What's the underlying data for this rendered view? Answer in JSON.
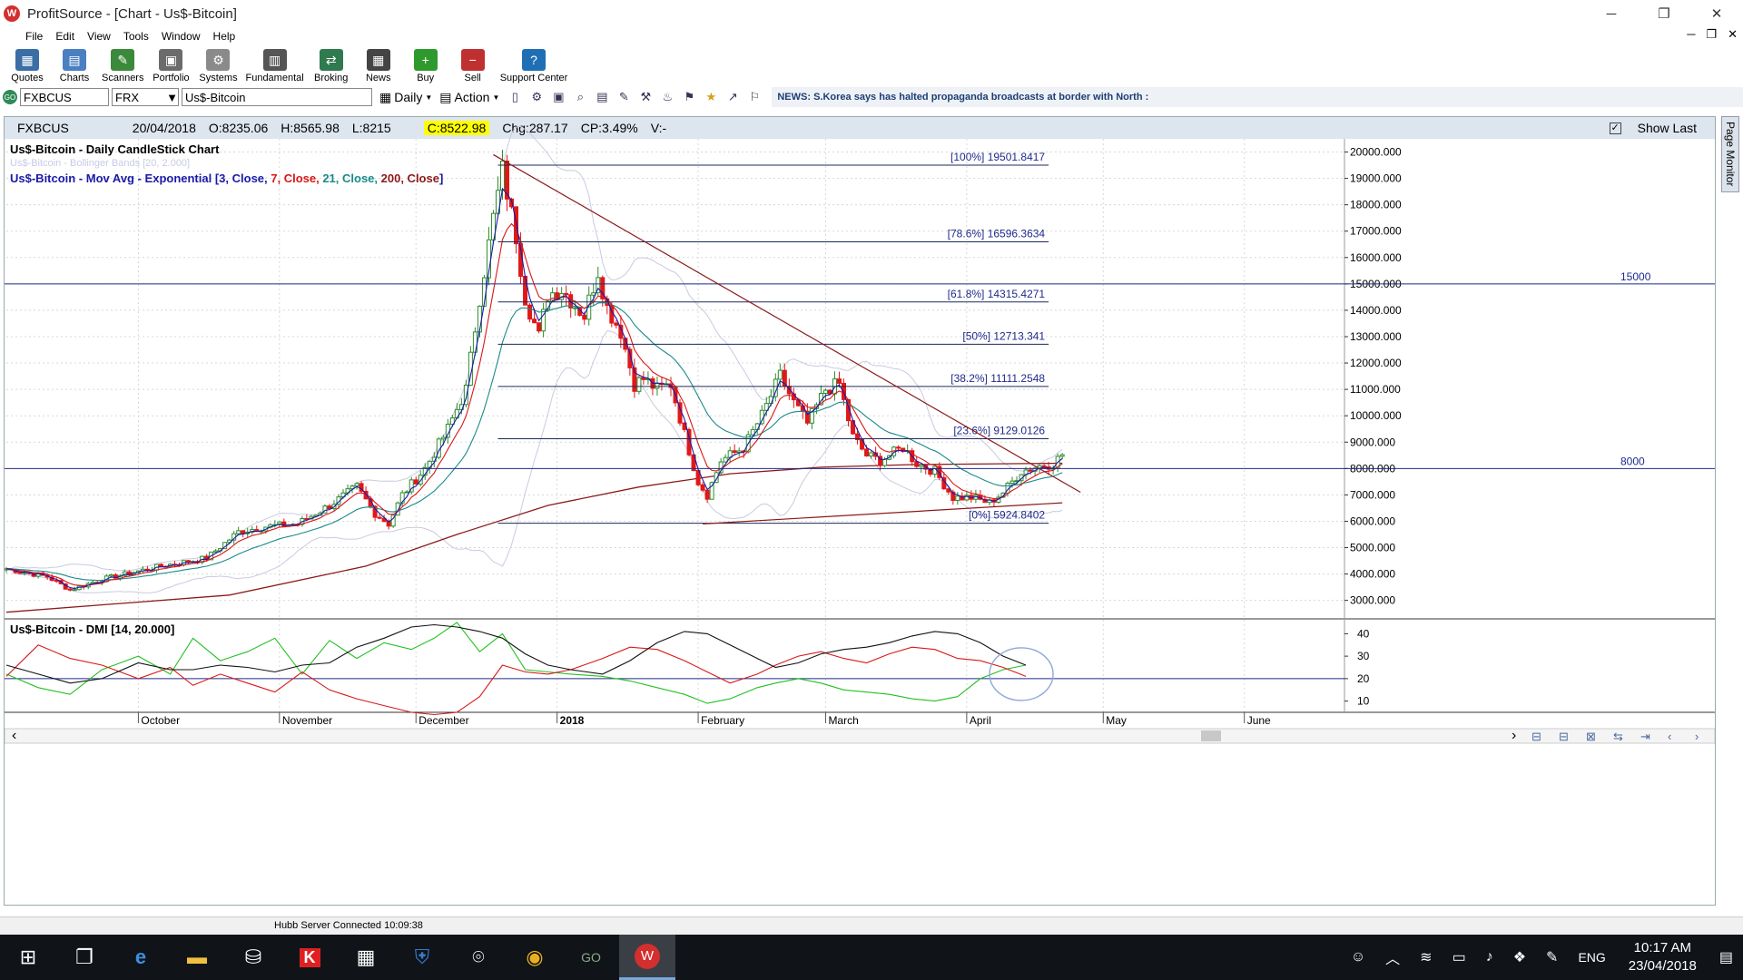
{
  "window": {
    "title": "ProfitSource - [Chart - Us$-Bitcoin]",
    "app_icon_text": "W"
  },
  "menu": [
    "File",
    "Edit",
    "View",
    "Tools",
    "Window",
    "Help"
  ],
  "toolbar": [
    {
      "label": "Quotes",
      "color": "#3a6ea5",
      "glyph": "▦"
    },
    {
      "label": "Charts",
      "color": "#4a7fc1",
      "glyph": "▤"
    },
    {
      "label": "Scanners",
      "color": "#3b8a3b",
      "glyph": "✎"
    },
    {
      "label": "Portfolio",
      "color": "#6b6b6b",
      "glyph": "▣"
    },
    {
      "label": "Systems",
      "color": "#8a8a8a",
      "glyph": "⚙"
    },
    {
      "label": "Fundamental",
      "color": "#555555",
      "glyph": "▥"
    },
    {
      "label": "Broking",
      "color": "#2f7a4f",
      "glyph": "⇄"
    },
    {
      "label": "News",
      "color": "#444444",
      "glyph": "▦"
    },
    {
      "label": "Buy",
      "color": "#2e9a2e",
      "glyph": "+"
    },
    {
      "label": "Sell",
      "color": "#c03030",
      "glyph": "−"
    },
    {
      "label": "Support Center",
      "color": "#1f6fb5",
      "glyph": "?"
    }
  ],
  "symbol_bar": {
    "go": "GO",
    "symbol": "FXBCUS",
    "exchange": "FRX",
    "name": "Us$-Bitcoin",
    "period": "Daily",
    "action": "Action",
    "news": "NEWS: S.Korea says has halted propaganda broadcasts at border with North :"
  },
  "info": {
    "code": "FXBCUS",
    "date": "20/04/2018",
    "open": "O:8235.06",
    "high": "H:8565.98",
    "low": "L:8215",
    "close": "C:8522.98",
    "change": "Chg:287.17",
    "cp": "CP:3.49%",
    "vol": "V:-",
    "show_last": "Show Last"
  },
  "page_monitor": "Page Monitor",
  "status": {
    "text": "Hubb Server Connected 10:09:38"
  },
  "taskbar": {
    "lang": "ENG",
    "time": "10:17 AM",
    "date": "23/04/2018"
  },
  "chart_data": {
    "type": "candlestick",
    "title": "Us$-Bitcoin - Daily CandleStick Chart",
    "subtitle": "Us$-Bitcoin - Bollinger Bands [20, 2.000]",
    "ma_prefix": "Us$-Bitcoin - Mov Avg - Exponential [",
    "ma_parts": [
      {
        "text": "3, Close, ",
        "color": "#1a1aa8"
      },
      {
        "text": "7, Close, ",
        "color": "#d81818"
      },
      {
        "text": "21, Close, ",
        "color": "#1a8a8a"
      },
      {
        "text": "200, Close",
        "color": "#8b1a1a"
      }
    ],
    "ma_suffix": "]",
    "y_ticks": [
      "20000.000",
      "19000.000",
      "18000.000",
      "17000.000",
      "16000.000",
      "15000.000",
      "14000.000",
      "13000.000",
      "12000.000",
      "11000.000",
      "10000.000",
      "9000.000",
      "8000.000",
      "7000.000",
      "6000.000",
      "5000.000",
      "4000.000",
      "3000.000"
    ],
    "y_range": [
      2300,
      20500
    ],
    "x_labels": [
      {
        "text": "October",
        "x": 0
      },
      {
        "text": "November",
        "x": 31
      },
      {
        "text": "December",
        "x": 61
      },
      {
        "text": "2018",
        "x": 92,
        "bold": true
      },
      {
        "text": "February",
        "x": 123
      },
      {
        "text": "March",
        "x": 151
      },
      {
        "text": "April",
        "x": 182
      },
      {
        "text": "May",
        "x": 212
      },
      {
        "text": "June",
        "x": 243
      }
    ],
    "x_domain": [
      -29,
      265
    ],
    "fibonacci": [
      {
        "label": "[100%] 19501.8417",
        "value": 19501.8417
      },
      {
        "label": "[78.6%] 16596.3634",
        "value": 16596.3634
      },
      {
        "label": "[61.8%] 14315.4271",
        "value": 14315.4271
      },
      {
        "label": "[50%] 12713.341",
        "value": 12713.341
      },
      {
        "label": "[38.2%] 11111.2548",
        "value": 11111.2548
      },
      {
        "label": "[23.6%] 9129.0126",
        "value": 9129.0126
      },
      {
        "label": "[0%] 5924.8402",
        "value": 5924.8402
      }
    ],
    "horizontal_lines": [
      {
        "label": "15000",
        "value": 15000
      },
      {
        "label": "8000",
        "value": 8000
      }
    ],
    "trendlines": [
      {
        "x1": 78,
        "y1": 19900,
        "x2": 207,
        "y2": 7100,
        "color": "#8b1a1a"
      },
      {
        "x1": 124,
        "y1": 5900,
        "x2": 203,
        "y2": 6700,
        "color": "#8b1a1a"
      }
    ],
    "anchors": [
      [
        -29,
        4200
      ],
      [
        -20,
        3900
      ],
      [
        -15,
        3400
      ],
      [
        -8,
        3800
      ],
      [
        5,
        4300
      ],
      [
        15,
        4600
      ],
      [
        22,
        5600
      ],
      [
        28,
        5800
      ],
      [
        35,
        5900
      ],
      [
        42,
        6600
      ],
      [
        48,
        7300
      ],
      [
        52,
        6300
      ],
      [
        55,
        5900
      ],
      [
        58,
        7000
      ],
      [
        63,
        8000
      ],
      [
        68,
        9500
      ],
      [
        72,
        11000
      ],
      [
        75,
        14500
      ],
      [
        78,
        17500
      ],
      [
        80,
        19300
      ],
      [
        83,
        16800
      ],
      [
        85,
        14500
      ],
      [
        88,
        13000
      ],
      [
        90,
        14600
      ],
      [
        93,
        14800
      ],
      [
        96,
        14200
      ],
      [
        98,
        13800
      ],
      [
        101,
        15500
      ],
      [
        103,
        14100
      ],
      [
        106,
        13200
      ],
      [
        109,
        11200
      ],
      [
        111,
        11400
      ],
      [
        114,
        11000
      ],
      [
        117,
        11200
      ],
      [
        120,
        9300
      ],
      [
        123,
        7500
      ],
      [
        125,
        7000
      ],
      [
        128,
        8300
      ],
      [
        133,
        8800
      ],
      [
        137,
        10000
      ],
      [
        141,
        11500
      ],
      [
        144,
        10500
      ],
      [
        147,
        9700
      ],
      [
        151,
        11000
      ],
      [
        154,
        11200
      ],
      [
        157,
        9200
      ],
      [
        160,
        8500
      ],
      [
        163,
        8300
      ],
      [
        168,
        8800
      ],
      [
        171,
        8200
      ],
      [
        175,
        7900
      ],
      [
        179,
        6900
      ],
      [
        183,
        6900
      ],
      [
        187,
        6700
      ],
      [
        190,
        7100
      ],
      [
        194,
        7900
      ],
      [
        198,
        8100
      ],
      [
        201,
        8200
      ],
      [
        203,
        8523
      ]
    ],
    "dmi": {
      "label": "Us$-Bitcoin - DMI [14, 20.000]",
      "y_ticks": [
        "40",
        "30",
        "20",
        "10"
      ],
      "y_range": [
        5,
        45
      ],
      "ref": 20,
      "plus_di": [
        [
          -29,
          22
        ],
        [
          -22,
          16
        ],
        [
          -15,
          13
        ],
        [
          -8,
          24
        ],
        [
          0,
          30
        ],
        [
          7,
          22
        ],
        [
          12,
          38
        ],
        [
          18,
          28
        ],
        [
          24,
          32
        ],
        [
          30,
          38
        ],
        [
          36,
          22
        ],
        [
          42,
          37
        ],
        [
          48,
          29
        ],
        [
          54,
          36
        ],
        [
          60,
          33
        ],
        [
          65,
          38
        ],
        [
          70,
          45
        ],
        [
          75,
          32
        ],
        [
          80,
          40
        ],
        [
          85,
          24
        ],
        [
          90,
          23
        ],
        [
          95,
          22
        ],
        [
          102,
          21
        ],
        [
          108,
          19
        ],
        [
          114,
          16
        ],
        [
          120,
          13
        ],
        [
          125,
          9
        ],
        [
          130,
          11
        ],
        [
          136,
          16
        ],
        [
          140,
          18
        ],
        [
          145,
          20
        ],
        [
          150,
          18
        ],
        [
          155,
          15
        ],
        [
          160,
          14
        ],
        [
          165,
          13
        ],
        [
          170,
          11
        ],
        [
          175,
          10
        ],
        [
          180,
          12
        ],
        [
          185,
          20
        ],
        [
          190,
          24
        ],
        [
          195,
          26
        ]
      ],
      "minus_di": [
        [
          -29,
          21
        ],
        [
          -22,
          35
        ],
        [
          -15,
          29
        ],
        [
          -8,
          26
        ],
        [
          0,
          20
        ],
        [
          7,
          25
        ],
        [
          12,
          17
        ],
        [
          18,
          22
        ],
        [
          24,
          18
        ],
        [
          30,
          14
        ],
        [
          36,
          23
        ],
        [
          42,
          15
        ],
        [
          48,
          11
        ],
        [
          54,
          8
        ],
        [
          60,
          5
        ],
        [
          65,
          4
        ],
        [
          70,
          5
        ],
        [
          75,
          12
        ],
        [
          80,
          26
        ],
        [
          85,
          23
        ],
        [
          90,
          22
        ],
        [
          95,
          24
        ],
        [
          102,
          29
        ],
        [
          108,
          34
        ],
        [
          114,
          33
        ],
        [
          120,
          28
        ],
        [
          125,
          23
        ],
        [
          130,
          18
        ],
        [
          136,
          22
        ],
        [
          140,
          26
        ],
        [
          145,
          30
        ],
        [
          150,
          32
        ],
        [
          155,
          29
        ],
        [
          160,
          27
        ],
        [
          165,
          31
        ],
        [
          170,
          34
        ],
        [
          175,
          33
        ],
        [
          180,
          29
        ],
        [
          185,
          28
        ],
        [
          190,
          25
        ],
        [
          195,
          21
        ]
      ],
      "adx": [
        [
          -29,
          26
        ],
        [
          -22,
          22
        ],
        [
          -15,
          18
        ],
        [
          -8,
          20
        ],
        [
          0,
          27
        ],
        [
          7,
          24
        ],
        [
          12,
          24
        ],
        [
          18,
          26
        ],
        [
          24,
          25
        ],
        [
          30,
          23
        ],
        [
          36,
          26
        ],
        [
          42,
          27
        ],
        [
          48,
          34
        ],
        [
          54,
          38
        ],
        [
          60,
          43
        ],
        [
          65,
          44
        ],
        [
          70,
          43
        ],
        [
          75,
          41
        ],
        [
          80,
          38
        ],
        [
          85,
          31
        ],
        [
          90,
          26
        ],
        [
          95,
          24
        ],
        [
          102,
          22
        ],
        [
          108,
          28
        ],
        [
          114,
          36
        ],
        [
          120,
          41
        ],
        [
          125,
          40
        ],
        [
          130,
          35
        ],
        [
          136,
          29
        ],
        [
          140,
          25
        ],
        [
          145,
          27
        ],
        [
          150,
          31
        ],
        [
          155,
          33
        ],
        [
          160,
          34
        ],
        [
          165,
          36
        ],
        [
          170,
          39
        ],
        [
          175,
          41
        ],
        [
          180,
          40
        ],
        [
          185,
          36
        ],
        [
          190,
          30
        ],
        [
          195,
          26
        ]
      ]
    }
  }
}
